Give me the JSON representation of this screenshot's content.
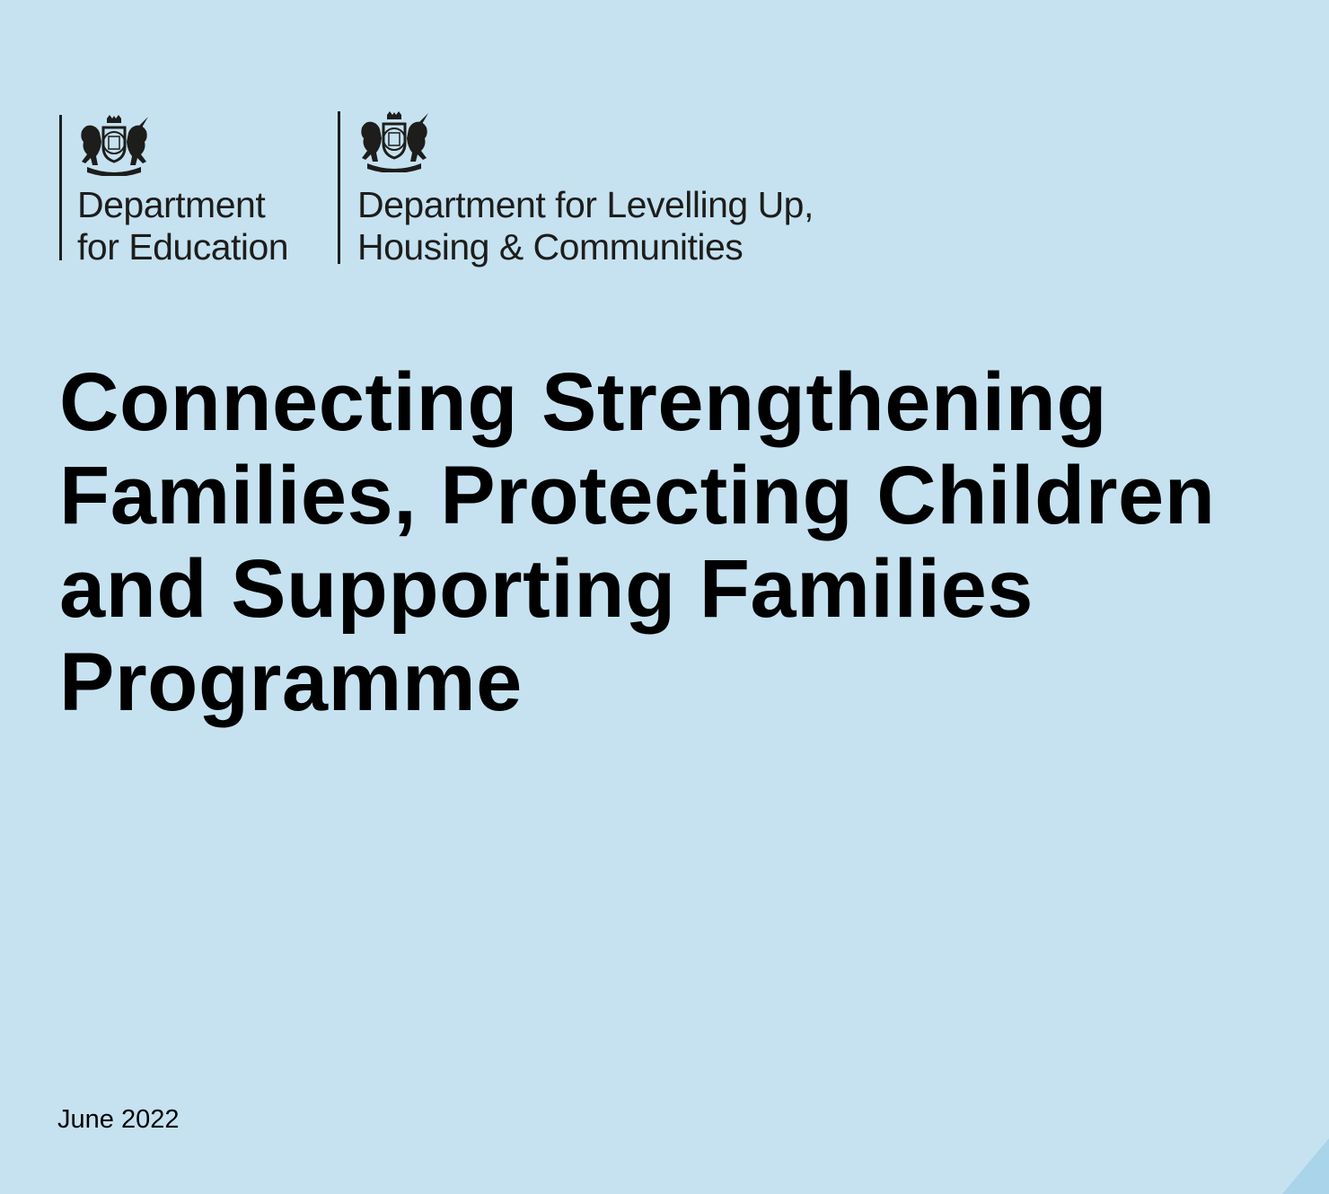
{
  "colors": {
    "background": "#c6e2f0",
    "text": "#000000",
    "logo_rule": "#1d1d1b",
    "corner_accent": "#a9d4ea"
  },
  "logos": {
    "dfe": {
      "icon": "royal-coat-of-arms-icon",
      "line1": "Department",
      "line2": "for Education"
    },
    "dluhc": {
      "icon": "royal-coat-of-arms-icon",
      "line1": "Department for Levelling Up,",
      "line2": "Housing & Communities"
    }
  },
  "document": {
    "title_lines": [
      "Connecting Strengthening",
      "Families, Protecting Children",
      "and Supporting Families",
      "Programme"
    ],
    "date": "June 2022"
  }
}
